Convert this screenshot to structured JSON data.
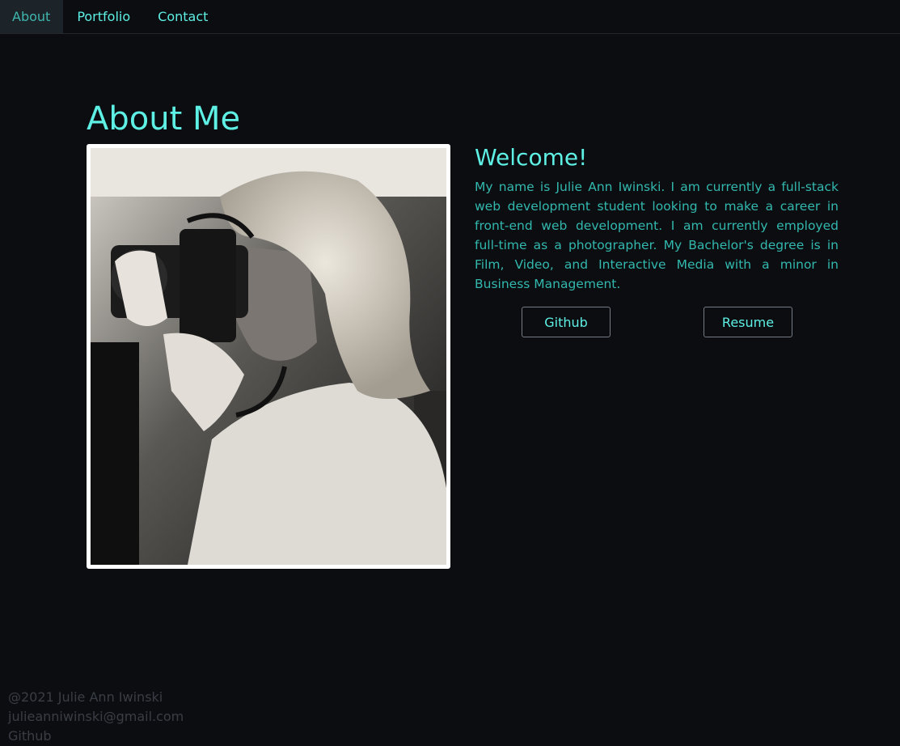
{
  "nav": {
    "items": [
      {
        "label": "About",
        "active": true
      },
      {
        "label": "Portfolio",
        "active": false
      },
      {
        "label": "Contact",
        "active": false
      }
    ]
  },
  "page": {
    "title": "About Me"
  },
  "about": {
    "heading": "Welcome!",
    "bio": "My name is Julie Ann Iwinski. I am currently a full-stack web development student looking to make a career in front-end web development. I am currently employed full-time as a photographer. My Bachelor's degree is in Film, Video, and Interactive Media with a minor in Business Management.",
    "buttons": {
      "github": "Github",
      "resume": "Resume"
    }
  },
  "footer": {
    "copyright": "@2021 Julie Ann Iwinski",
    "email": "julieanniwinski@gmail.com",
    "github": "Github"
  },
  "colors": {
    "background": "#0b0d11",
    "accent": "#5ef0e4",
    "body_text": "#33b8ae",
    "footer_text": "#3a3e44"
  }
}
